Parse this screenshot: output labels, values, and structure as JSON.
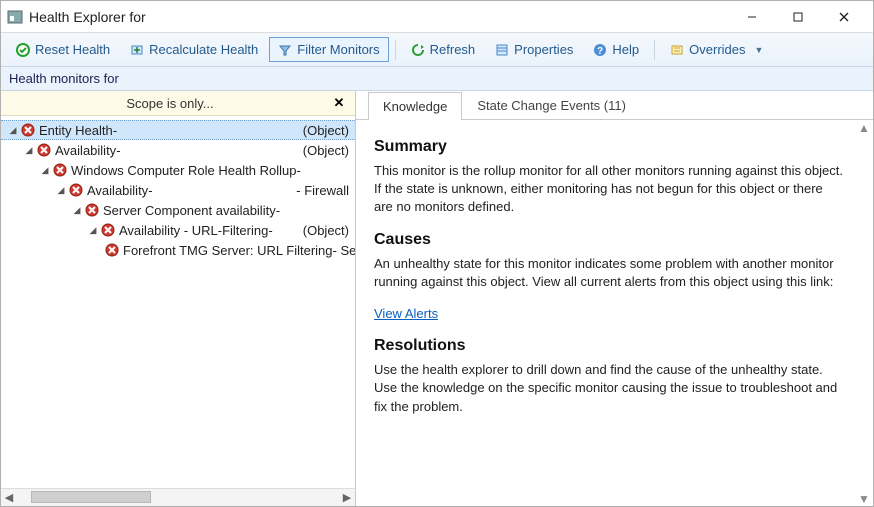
{
  "window": {
    "title": "Health Explorer for"
  },
  "toolbar": {
    "reset": "Reset Health",
    "recalculate": "Recalculate Health",
    "filter": "Filter Monitors",
    "refresh": "Refresh",
    "properties": "Properties",
    "help": "Help",
    "overrides": "Overrides"
  },
  "subheader": "Health monitors for",
  "scope": {
    "label": "Scope is only..."
  },
  "tree": {
    "nodes": [
      {
        "indent": 0,
        "expanded": true,
        "label": "Entity Health",
        "suffix": " - ",
        "type": "(Object)",
        "selected": true
      },
      {
        "indent": 1,
        "expanded": true,
        "label": "Availability",
        "suffix": " - ",
        "type": "(Object)"
      },
      {
        "indent": 2,
        "expanded": true,
        "label": "Windows Computer Role Health Rollup",
        "suffix": " -",
        "type": ""
      },
      {
        "indent": 3,
        "expanded": true,
        "label": "Availability",
        "suffix": " - ",
        "type": "- Firewall"
      },
      {
        "indent": 4,
        "expanded": true,
        "label": "Server Component availability",
        "suffix": " - ",
        "type": ""
      },
      {
        "indent": 5,
        "expanded": true,
        "label": "Availability - URL-Filtering",
        "suffix": " - ",
        "type": "(Object)"
      },
      {
        "indent": 6,
        "expanded": false,
        "leaf": true,
        "label": "Forefront TMG Server: URL Filtering",
        "suffix": " - Server",
        "type": ""
      }
    ]
  },
  "tabs": {
    "knowledge": "Knowledge",
    "events": "State Change Events (11)"
  },
  "knowledge": {
    "summary_h": "Summary",
    "summary_p": "This monitor is the rollup monitor for all other monitors running against this object. If the state is unknown, either monitoring has not begun for this object or there are no monitors defined.",
    "causes_h": "Causes",
    "causes_p": "An unhealthy state for this monitor indicates some problem with another monitor running against this object. View all current alerts from this object using this link:",
    "view_alerts": "View Alerts",
    "resolutions_h": "Resolutions",
    "resolutions_p": "Use the health explorer to drill down and find the cause of the unhealthy state. Use the knowledge on the specific monitor causing the issue to troubleshoot and fix the problem."
  }
}
